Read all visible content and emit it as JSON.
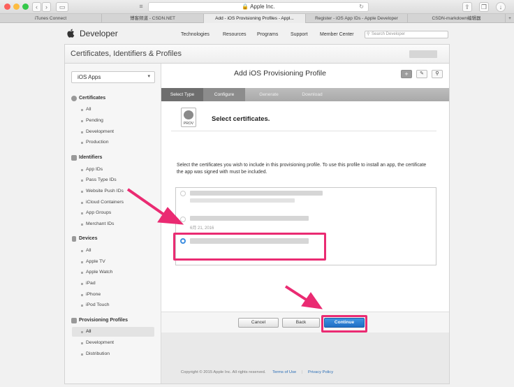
{
  "browser": {
    "url": "Apple Inc.",
    "tabs": [
      {
        "label": "iTunes Connect"
      },
      {
        "label": "博客频道 - CSDN.NET"
      },
      {
        "label": "Add - iOS Provisioning Profiles - Appl..."
      },
      {
        "label": "Register - iOS App IDs - Apple Developer"
      },
      {
        "label": "CSDN-markdown编辑器"
      }
    ]
  },
  "header": {
    "brand": "Developer",
    "nav": [
      "Technologies",
      "Resources",
      "Programs",
      "Support",
      "Member Center"
    ],
    "search_placeholder": "Search Developer"
  },
  "card_title": "Certificates, Identifiers & Profiles",
  "sidebar": {
    "platform": "iOS Apps",
    "sections": [
      {
        "title": "Certificates",
        "items": [
          "All",
          "Pending",
          "Development",
          "Production"
        ]
      },
      {
        "title": "Identifiers",
        "items": [
          "App IDs",
          "Pass Type IDs",
          "Website Push IDs",
          "iCloud Containers",
          "App Groups",
          "Merchant IDs"
        ]
      },
      {
        "title": "Devices",
        "items": [
          "All",
          "Apple TV",
          "Apple Watch",
          "iPad",
          "iPhone",
          "iPod Touch"
        ]
      },
      {
        "title": "Provisioning Profiles",
        "items": [
          "All",
          "Development",
          "Distribution"
        ]
      }
    ]
  },
  "main": {
    "title": "Add iOS Provisioning Profile",
    "steps": [
      "Select Type",
      "Configure",
      "Generate",
      "Download"
    ],
    "file_badge": "PROV",
    "heading": "Select certificates.",
    "description": "Select the certificates you wish to include in this provisioning profile. To use this profile to install an app, the certificate the app was signed with must be included.",
    "cert_date": "6月 21, 2016",
    "buttons": {
      "cancel": "Cancel",
      "back": "Back",
      "continue": "Continue"
    }
  },
  "footer": {
    "copyright": "Copyright © 2015 Apple Inc. All rights reserved.",
    "terms": "Terms of Use",
    "privacy": "Privacy Policy"
  },
  "colors": {
    "accent": "#1f6fc5",
    "highlight": "#ea2b72"
  }
}
